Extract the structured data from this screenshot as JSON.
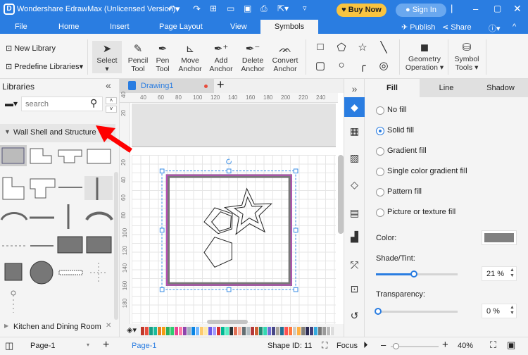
{
  "title_bar": {
    "title": "Wondershare EdrawMax (Unlicensed Version)",
    "buy_now": "Buy Now",
    "sign_in": "Sign In",
    "accent": "#2a7de1",
    "buy_color": "#f9c440"
  },
  "menu": {
    "items": [
      "File",
      "Home",
      "Insert",
      "Page Layout",
      "View",
      "Symbols"
    ],
    "active": "Symbols",
    "publish": "Publish",
    "share": "Share"
  },
  "ribbon": {
    "new_library": "New Library",
    "predefine_libraries": "Predefine Libraries",
    "tools": [
      {
        "label1": "Select",
        "label2": ""
      },
      {
        "label1": "Pencil",
        "label2": "Tool"
      },
      {
        "label1": "Pen",
        "label2": "Tool"
      },
      {
        "label1": "Move",
        "label2": "Anchor"
      },
      {
        "label1": "Add",
        "label2": "Anchor"
      },
      {
        "label1": "Delete",
        "label2": "Anchor"
      },
      {
        "label1": "Convert",
        "label2": "Anchor"
      }
    ],
    "geometry_operation": [
      "Geometry",
      "Operation"
    ],
    "symbol_tools": [
      "Symbol",
      "Tools"
    ]
  },
  "libraries": {
    "title": "Libraries",
    "search_placeholder": "search",
    "section": "Wall Shell and Structure",
    "next_section": "Kitchen and Dining Room"
  },
  "document": {
    "tab": "Drawing1",
    "ruler_x": [
      "40",
      "60",
      "80",
      "100",
      "120",
      "140",
      "160",
      "180",
      "200",
      "220",
      "240"
    ],
    "ruler_y": [
      "40",
      "20",
      "20",
      "40",
      "60",
      "80",
      "100",
      "120",
      "140",
      "160",
      "180"
    ],
    "frame_color": "#c440c4",
    "wall_color": "#777777"
  },
  "palette": [
    "#c0392b",
    "#e74c3c",
    "#16a085",
    "#1abc9c",
    "#e67e22",
    "#f39c12",
    "#27ae60",
    "#2ecc71",
    "#e84393",
    "#fd79a8",
    "#8e44ad",
    "#a4b0be",
    "#0984e3",
    "#74b9ff",
    "#fdcb6e",
    "#ffeaa7",
    "#6c5ce7",
    "#a29bfe",
    "#d63031",
    "#00b894",
    "#55efc4",
    "#2d3436",
    "#e17055",
    "#fab1a0",
    "#636e72",
    "#b2bec3",
    "#b33939",
    "#cd6133",
    "#218c74",
    "#33d9b2",
    "#706fd3",
    "#474787",
    "#aaa69d",
    "#227093",
    "#ff5252",
    "#ff793f",
    "#d1ccc0",
    "#ffb142",
    "#84817a",
    "#2c2c54",
    "#40407a",
    "#34ace0",
    "#777",
    "#999",
    "#bbb",
    "#ddd"
  ],
  "format_panel": {
    "tabs": [
      "Fill",
      "Line",
      "Shadow"
    ],
    "active_tab": "Fill",
    "fill_options": [
      "No fill",
      "Solid fill",
      "Gradient fill",
      "Single color gradient fill",
      "Pattern fill",
      "Picture or texture fill"
    ],
    "selected_fill": "Solid fill",
    "color_label": "Color:",
    "color_value": "#808080",
    "shade_label": "Shade/Tint:",
    "shade_value": "21 %",
    "shade_percent": 21,
    "transparency_label": "Transparency:",
    "transparency_value": "0 %",
    "transparency_percent": 0
  },
  "status_bar": {
    "page_select": "Page-1",
    "page_tab": "Page-1",
    "shape_id": "Shape ID: 11",
    "focus": "Focus",
    "zoom": "40%"
  }
}
